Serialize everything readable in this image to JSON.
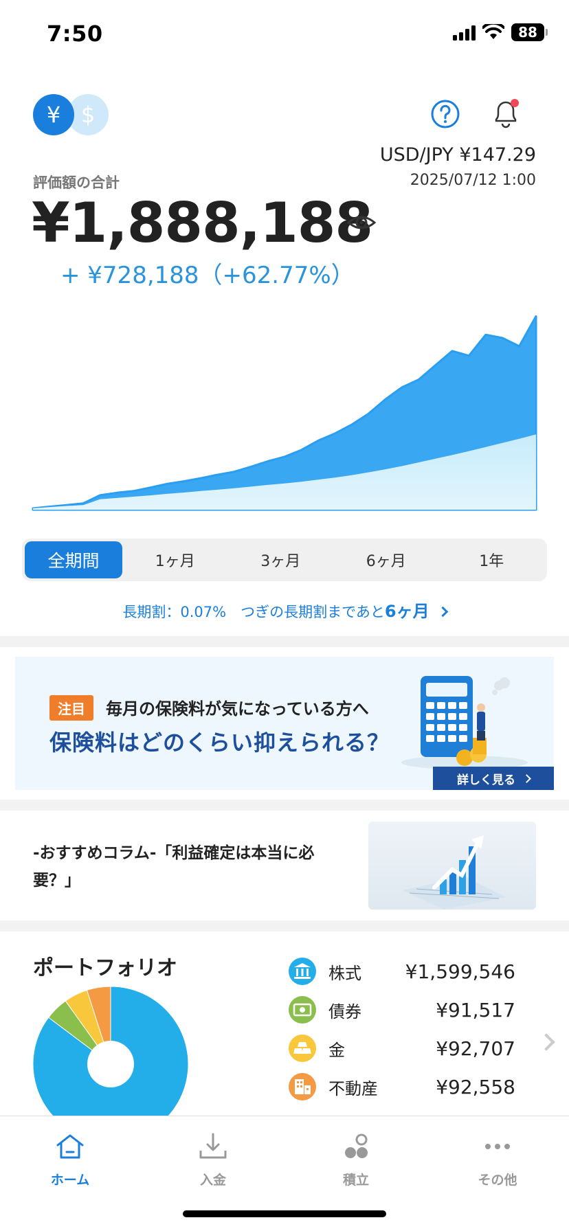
{
  "status_bar": {
    "time": "7:50",
    "battery": "88"
  },
  "header": {
    "currency_yen": "¥",
    "currency_usd": "$",
    "fx_rate": "USD/JPY  ¥147.29",
    "fx_date": "2025/07/12 1:00"
  },
  "summary": {
    "label": "評価額の合計",
    "total": "¥1,888,188",
    "gain": "+ ¥728,188（+62.77%）"
  },
  "chart_data": {
    "type": "area",
    "series": [
      {
        "values": [
          0,
          0.6,
          1.1,
          1.5,
          4.2,
          4.8,
          5.4,
          6.0,
          6.7,
          7.3,
          8.0,
          8.6,
          9.3,
          10.0,
          10.8,
          11.5,
          12.3,
          13.2,
          14.2,
          15.3,
          16.6,
          18.0,
          19.5,
          21.2,
          22.9,
          24.6,
          26.4,
          28.3,
          30.2,
          32.1,
          34.1
        ]
      },
      {
        "values": [
          0,
          0.8,
          1.5,
          2.3,
          6.1,
          7.2,
          8.0,
          9.6,
          11.3,
          12.5,
          13.9,
          15.5,
          16.9,
          19.2,
          21.7,
          23.8,
          26.9,
          31.2,
          34.5,
          38.6,
          43.6,
          50.2,
          55.8,
          59.4,
          66.0,
          72.6,
          70.4,
          80.1,
          78.6,
          74.8,
          88.6
        ]
      }
    ]
  },
  "period_tabs": [
    "全期間",
    "1ヶ月",
    "3ヶ月",
    "6ヶ月",
    "1年"
  ],
  "long_term": {
    "prefix": "長期割：0.07%　つぎの長期割まであと",
    "months": "6ヶ月"
  },
  "banner": {
    "tag": "注目",
    "subtitle": "毎月の保険料が気になっている方へ",
    "title": "保険料はどのくらい抑えられる？",
    "button": "詳しく見る"
  },
  "column": {
    "text": "-おすすめコラム-「利益確定は本当に必要？」"
  },
  "portfolio": {
    "title": "ポートフォリオ",
    "items": [
      {
        "name": "株式",
        "value": "¥1,599,546",
        "color": "#23aee9",
        "icon": "bank-icon"
      },
      {
        "name": "債券",
        "value": "¥91,517",
        "color": "#8bbf4d",
        "icon": "bill-icon"
      },
      {
        "name": "金",
        "value": "¥92,707",
        "color": "#f8c73b",
        "icon": "gold-bar-icon"
      },
      {
        "name": "不動産",
        "value": "¥92,558",
        "color": "#f49a42",
        "icon": "building-icon"
      }
    ]
  },
  "bottom_nav": [
    {
      "label": "ホーム",
      "active": true
    },
    {
      "label": "入金",
      "active": false
    },
    {
      "label": "積立",
      "active": false
    },
    {
      "label": "その他",
      "active": false
    }
  ]
}
